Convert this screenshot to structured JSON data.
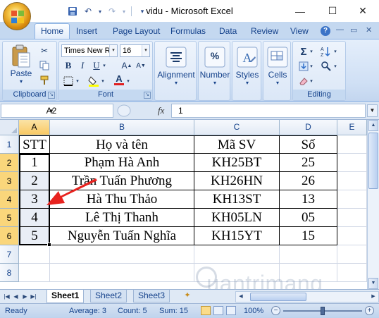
{
  "window": {
    "title": "vidu - Microsoft Excel",
    "min_glyph": "—",
    "max_glyph": "☐",
    "close_glyph": "✕"
  },
  "ribbon": {
    "tabs": [
      "Home",
      "Insert",
      "Page Layout",
      "Formulas",
      "Data",
      "Review",
      "View"
    ],
    "clipboard": {
      "paste_label": "Paste",
      "group_label": "Clipboard"
    },
    "font": {
      "name": "Times New Roman",
      "name_shown": "Times New Ro",
      "size": "16",
      "group_label": "Font",
      "bold": "B",
      "italic": "I",
      "underline": "U",
      "font_color": "#e02020",
      "fill_color": "#ffff00"
    },
    "alignment": {
      "label": "Alignment"
    },
    "number": {
      "label": "Number",
      "glyph": "%"
    },
    "styles": {
      "label": "Styles"
    },
    "cells": {
      "label": "Cells"
    },
    "editing": {
      "group_label": "Editing",
      "sum_glyph": "Σ"
    }
  },
  "formula_bar": {
    "name_box": "A2",
    "fx": "fx",
    "value": "1"
  },
  "sheet": {
    "columns": [
      "A",
      "B",
      "C",
      "D",
      "E"
    ],
    "selected_column": "A",
    "rows": [
      "1",
      "2",
      "3",
      "4",
      "5",
      "6",
      "7",
      "8"
    ],
    "selected_rows": [
      "2",
      "3",
      "4",
      "5",
      "6"
    ],
    "header": [
      "STT",
      "Họ và tên",
      "Mã SV",
      "Số"
    ],
    "data": [
      [
        "1",
        "Phạm Hà Anh",
        "KH25BT",
        "25"
      ],
      [
        "2",
        "Trần Tuấn Phương",
        "KH26HN",
        "26"
      ],
      [
        "3",
        "Hà Thu Thảo",
        "KH13ST",
        "13"
      ],
      [
        "4",
        "Lê Thị Thanh",
        "KH05LN",
        "05"
      ],
      [
        "5",
        "Nguyễn Tuấn Nghĩa",
        "KH15YT",
        "15"
      ]
    ]
  },
  "sheet_tabs": [
    "Sheet1",
    "Sheet2",
    "Sheet3"
  ],
  "active_sheet": "Sheet1",
  "status_bar": {
    "ready": "Ready",
    "average": "Average: 3",
    "count": "Count: 5",
    "sum": "Sum: 15",
    "zoom": "100%"
  },
  "watermark": {
    "text": "uantrimang"
  },
  "colors": {
    "annotation_arrow": "#e8231f",
    "selection_header": "#f9c963"
  }
}
